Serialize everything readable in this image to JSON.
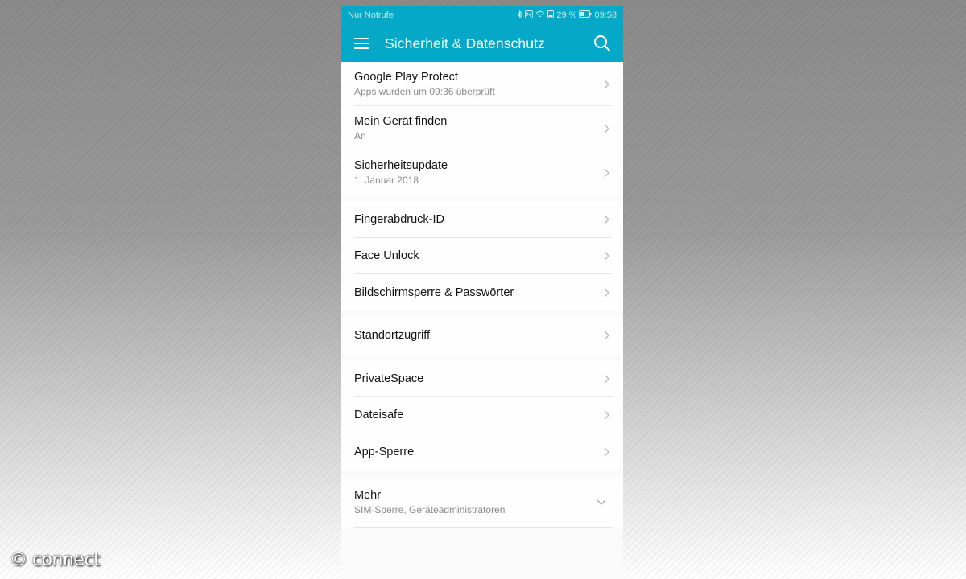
{
  "statusbar": {
    "carrier": "Nur Notrufe",
    "battery": "29 %",
    "time": "09:58",
    "icons": [
      "bluetooth-icon",
      "nfc-icon",
      "wifi-icon",
      "battery-icon"
    ]
  },
  "appbar": {
    "title": "Sicherheit & Datenschutz",
    "color": "#05a9c7"
  },
  "groups": [
    {
      "items": [
        {
          "label": "Google Play Protect",
          "sub": "Apps wurden um 09:36 überprüft"
        },
        {
          "label": "Mein Gerät finden",
          "sub": "An"
        },
        {
          "label": "Sicherheitsupdate",
          "sub": "1. Januar 2018"
        }
      ]
    },
    {
      "items": [
        {
          "label": "Fingerabdruck-ID"
        },
        {
          "label": "Face Unlock"
        },
        {
          "label": "Bildschirmsperre & Passwörter"
        }
      ]
    },
    {
      "items": [
        {
          "label": "Standortzugriff"
        }
      ]
    },
    {
      "items": [
        {
          "label": "PrivateSpace"
        },
        {
          "label": "Dateisafe"
        },
        {
          "label": "App-Sperre"
        }
      ]
    }
  ],
  "more": {
    "label": "Mehr",
    "sub": "SIM-Sperre, Geräteadministratoren"
  },
  "watermark": "© connect"
}
